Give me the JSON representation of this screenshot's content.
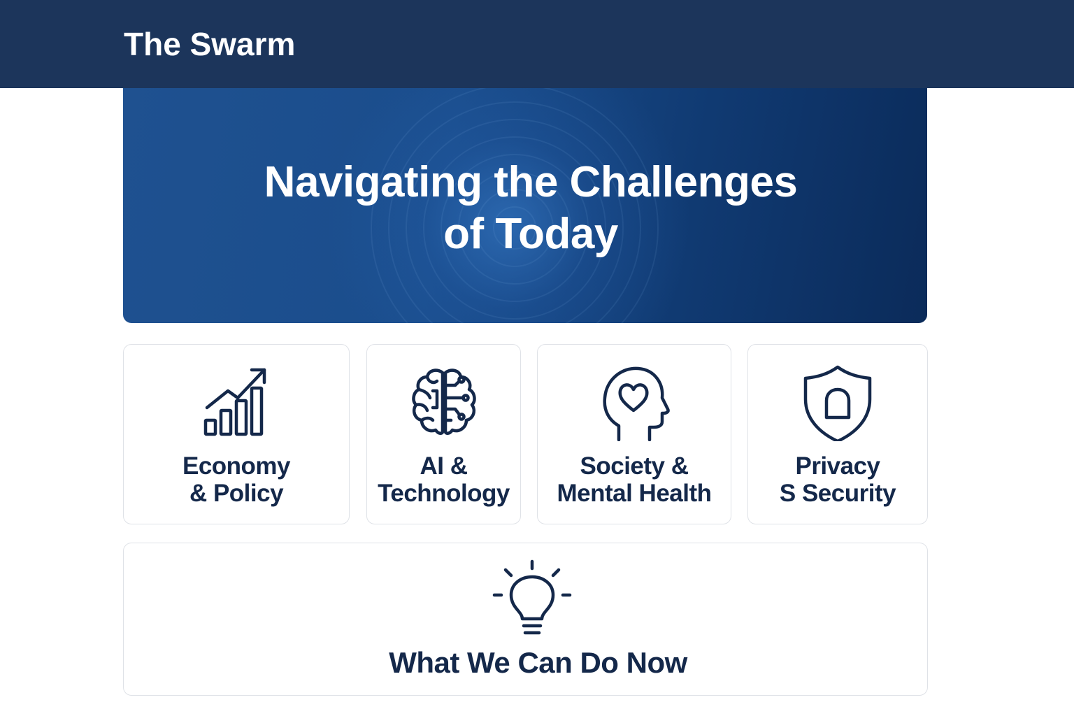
{
  "header": {
    "brand": "The Swarm"
  },
  "hero": {
    "title_line1": "Navigating the Challenges",
    "title_line2": "of Today"
  },
  "topics": [
    {
      "label_line1": "Economy",
      "label_line2": "& Policy",
      "icon": "growth-chart-icon"
    },
    {
      "label_line1": "AI &",
      "label_line2": "Technology",
      "icon": "brain-circuit-icon"
    },
    {
      "label_line1": "Society &",
      "label_line2": "Mental Health",
      "icon": "head-heart-icon"
    },
    {
      "label_line1": "Privacy",
      "label_line2": "S Security",
      "icon": "shield-lock-icon"
    }
  ],
  "action": {
    "label": "What We Can Do Now",
    "icon": "lightbulb-icon"
  },
  "colors": {
    "header_bg": "#1c355b",
    "hero_bg": "#1a4d8c",
    "text_dark": "#14284a",
    "card_border": "#dfe2e7"
  }
}
